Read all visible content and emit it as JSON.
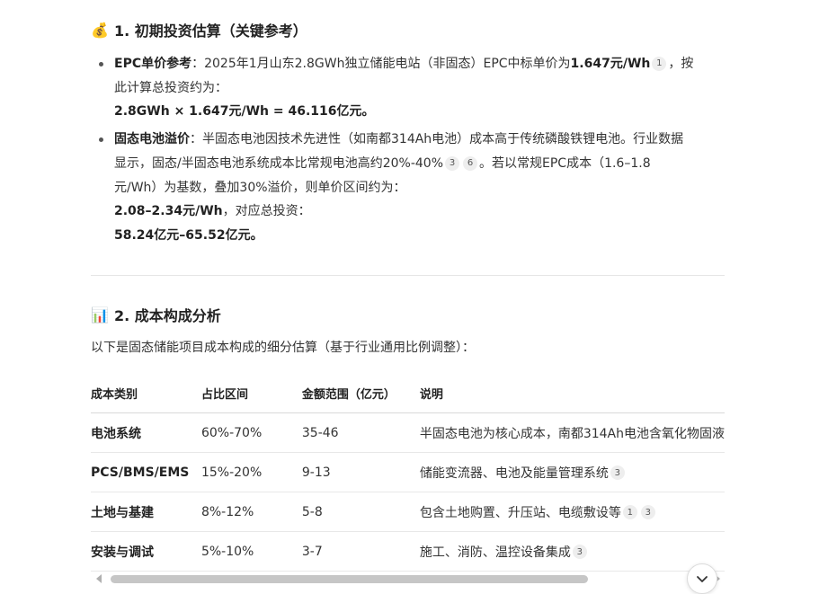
{
  "section1": {
    "emoji": "💰",
    "title": "1. 初期投资估算（关键参考）",
    "bullets": [
      {
        "lead": "EPC单价参考",
        "line1_text": "：2025年1月山东2.8GWh独立储能电站（非固态）EPC中标单价为",
        "line1_bold": "1.647元/Wh",
        "cite": "1",
        "line1_tail": "，按",
        "line2": "此计算总投资约为：",
        "line3": "2.8GWh × 1.647元/Wh = 46.116亿元。"
      },
      {
        "lead": "固态电池溢价",
        "line1_text": "：半固态电池因技术先进性（如南都314Ah电池）成本高于传统磷酸铁锂电池。行业数据",
        "line2_text": "显示，固态/半固态电池系统成本比常规电池高约20%-40%",
        "cite_a": "3",
        "cite_b": "6",
        "line2_tail": "。若以常规EPC成本（1.6–1.8",
        "line3": "元/Wh）为基数，叠加30%溢价，则单价区间约为：",
        "line4_bold": "2.08–2.34元/Wh",
        "line4_tail": "，对应总投资：",
        "line5": "58.24亿元–65.52亿元。"
      }
    ]
  },
  "section2": {
    "emoji": "📊",
    "title": "2. 成本构成分析",
    "intro": "以下是固态储能项目成本构成的细分估算（基于行业通用比例调整）：",
    "headers": [
      "成本类别",
      "占比区间",
      "金额范围（亿元）",
      "说明"
    ],
    "rows": [
      {
        "category": "电池系统",
        "share": "60%-70%",
        "amount": "35-46",
        "note": "半固态电池为核心成本，南都314Ah电池含氧化物固液",
        "cites": []
      },
      {
        "category": "PCS/BMS/EMS",
        "share": "15%-20%",
        "amount": "9-13",
        "note": "储能变流器、电池及能量管理系统",
        "cites": [
          "3"
        ]
      },
      {
        "category": "土地与基建",
        "share": "8%-12%",
        "amount": "5-8",
        "note": "包含土地购置、升压站、电缆敷设等",
        "cites": [
          "1",
          "3"
        ]
      },
      {
        "category": "安装与调试",
        "share": "5%-10%",
        "amount": "3-7",
        "note": "施工、消防、温控设备集成",
        "cites": [
          "3"
        ]
      }
    ]
  },
  "icons": {
    "scroll_down": "chevron-down-icon",
    "scroll_left": "arrow-left-icon",
    "scroll_right": "arrow-right-icon"
  }
}
